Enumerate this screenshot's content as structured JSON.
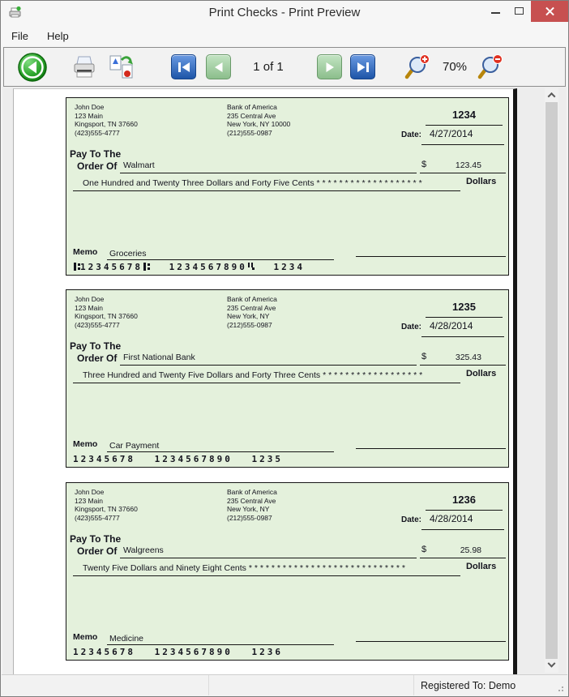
{
  "window": {
    "title": "Print Checks - Print Preview"
  },
  "menu": {
    "file": "File",
    "help": "Help"
  },
  "toolbar": {
    "page_indicator": "1 of 1",
    "zoom_level": "70%",
    "icons": [
      "back",
      "print",
      "export-image",
      "first-page",
      "previous-page",
      "next-page",
      "last-page",
      "zoom-in",
      "zoom-out"
    ]
  },
  "check_labels": {
    "date": "Date:",
    "pay_to_line1": "Pay To The",
    "pay_to_line2": "Order Of",
    "dollar_sign": "$",
    "dollars": "Dollars",
    "memo": "Memo"
  },
  "checks": [
    {
      "payer": {
        "name": "John Doe",
        "street": "123 Main",
        "city": "Kingsport, TN 37660",
        "phone": "(423)555-4777"
      },
      "bank": {
        "name": "Bank of America",
        "street": "235 Central Ave",
        "city": "New York, NY 10000",
        "phone": "(212)555-0987"
      },
      "number": "1234",
      "date": "4/27/2014",
      "payee": "Walmart",
      "amount": "123.45",
      "amount_words": "One Hundred and Twenty Three Dollars and Forty Five Cents * * * * * * * * * * * * * * * * * * *",
      "memo": "Groceries",
      "micr": {
        "symbols": true,
        "routing": "12345678",
        "account": "1234567890",
        "check_number": "1234"
      }
    },
    {
      "payer": {
        "name": "John Doe",
        "street": "123 Main",
        "city": "Kingsport, TN 37660",
        "phone": "(423)555-4777"
      },
      "bank": {
        "name": "Bank of America",
        "street": "235 Central Ave",
        "city": "New York, NY",
        "phone": "(212)555-0987"
      },
      "number": "1235",
      "date": "4/28/2014",
      "payee": "First National Bank",
      "amount": "325.43",
      "amount_words": "Three Hundred and Twenty Five Dollars and Forty Three Cents * * * * * * * * * * * * * * * * * *",
      "memo": "Car Payment",
      "micr": {
        "symbols": false,
        "routing": "12345678",
        "account": "1234567890",
        "check_number": "1235"
      }
    },
    {
      "payer": {
        "name": "John Doe",
        "street": "123 Main",
        "city": "Kingsport, TN 37660",
        "phone": "(423)555-4777"
      },
      "bank": {
        "name": "Bank of America",
        "street": "235 Central Ave",
        "city": "New York, NY",
        "phone": "(212)555-0987"
      },
      "number": "1236",
      "date": "4/28/2014",
      "payee": "Walgreens",
      "amount": "25.98",
      "amount_words": "Twenty Five Dollars and Ninety Eight Cents * * * * * * * * * * * * * * * * * * * * * * * * * * * *",
      "memo": "Medicine",
      "micr": {
        "symbols": false,
        "routing": "12345678",
        "account": "1234567890",
        "check_number": "1236"
      }
    }
  ],
  "status": {
    "registered": "Registered To: Demo"
  },
  "colors": {
    "check_background": "#e4f1dc",
    "close_button": "#c75050",
    "nav_blue": "#1e55a8",
    "nav_green": "#8cbe8c"
  }
}
